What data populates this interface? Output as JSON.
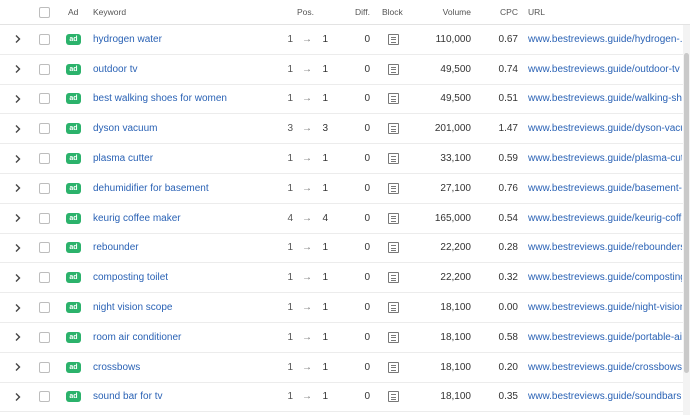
{
  "header": {
    "ad": "Ad",
    "keyword": "Keyword",
    "pos": "Pos.",
    "diff": "Diff.",
    "block": "Block",
    "volume": "Volume",
    "cpc": "CPC",
    "url": "URL"
  },
  "icons": {
    "expand": "chevron-right-icon",
    "block": "document-icon",
    "arrow": "arrow-right-icon"
  },
  "colors": {
    "ad_badge": "#2bb26b",
    "link": "#2a62b5"
  },
  "rows": [
    {
      "ad": "ad",
      "keyword": "hydrogen water",
      "pos_from": "1",
      "arrow": "→",
      "pos_to": "1",
      "diff": "0",
      "volume": "110,000",
      "cpc": "0.67",
      "url": "www.bestreviews.guide/hydrogen-..."
    },
    {
      "ad": "ad",
      "keyword": "outdoor tv",
      "pos_from": "1",
      "arrow": "→",
      "pos_to": "1",
      "diff": "0",
      "volume": "49,500",
      "cpc": "0.74",
      "url": "www.bestreviews.guide/outdoor-tv"
    },
    {
      "ad": "ad",
      "keyword": "best walking shoes for women",
      "pos_from": "1",
      "arrow": "→",
      "pos_to": "1",
      "diff": "0",
      "volume": "49,500",
      "cpc": "0.51",
      "url": "www.bestreviews.guide/walking-sh"
    },
    {
      "ad": "ad",
      "keyword": "dyson vacuum",
      "pos_from": "3",
      "arrow": "→",
      "pos_to": "3",
      "diff": "0",
      "volume": "201,000",
      "cpc": "1.47",
      "url": "www.bestreviews.guide/dyson-vacu"
    },
    {
      "ad": "ad",
      "keyword": "plasma cutter",
      "pos_from": "1",
      "arrow": "→",
      "pos_to": "1",
      "diff": "0",
      "volume": "33,100",
      "cpc": "0.59",
      "url": "www.bestreviews.guide/plasma-cut"
    },
    {
      "ad": "ad",
      "keyword": "dehumidifier for basement",
      "pos_from": "1",
      "arrow": "→",
      "pos_to": "1",
      "diff": "0",
      "volume": "27,100",
      "cpc": "0.76",
      "url": "www.bestreviews.guide/basement-"
    },
    {
      "ad": "ad",
      "keyword": "keurig coffee maker",
      "pos_from": "4",
      "arrow": "→",
      "pos_to": "4",
      "diff": "0",
      "volume": "165,000",
      "cpc": "0.54",
      "url": "www.bestreviews.guide/keurig-coff"
    },
    {
      "ad": "ad",
      "keyword": "rebounder",
      "pos_from": "1",
      "arrow": "→",
      "pos_to": "1",
      "diff": "0",
      "volume": "22,200",
      "cpc": "0.28",
      "url": "www.bestreviews.guide/rebounders"
    },
    {
      "ad": "ad",
      "keyword": "composting toilet",
      "pos_from": "1",
      "arrow": "→",
      "pos_to": "1",
      "diff": "0",
      "volume": "22,200",
      "cpc": "0.32",
      "url": "www.bestreviews.guide/composting"
    },
    {
      "ad": "ad",
      "keyword": "night vision scope",
      "pos_from": "1",
      "arrow": "→",
      "pos_to": "1",
      "diff": "0",
      "volume": "18,100",
      "cpc": "0.00",
      "url": "www.bestreviews.guide/night-vision"
    },
    {
      "ad": "ad",
      "keyword": "room air conditioner",
      "pos_from": "1",
      "arrow": "→",
      "pos_to": "1",
      "diff": "0",
      "volume": "18,100",
      "cpc": "0.58",
      "url": "www.bestreviews.guide/portable-ai"
    },
    {
      "ad": "ad",
      "keyword": "crossbows",
      "pos_from": "1",
      "arrow": "→",
      "pos_to": "1",
      "diff": "0",
      "volume": "18,100",
      "cpc": "0.20",
      "url": "www.bestreviews.guide/crossbows"
    },
    {
      "ad": "ad",
      "keyword": "sound bar for tv",
      "pos_from": "1",
      "arrow": "→",
      "pos_to": "1",
      "diff": "0",
      "volume": "18,100",
      "cpc": "0.35",
      "url": "www.bestreviews.guide/soundbars"
    }
  ]
}
